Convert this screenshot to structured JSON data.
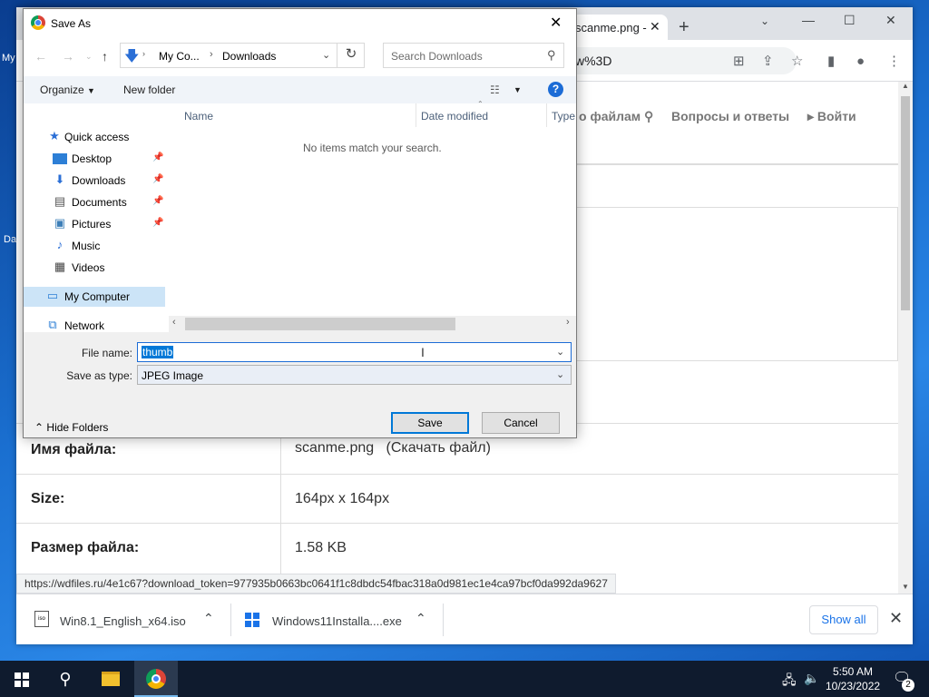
{
  "desktop": {
    "label_my": "My",
    "label_da": "Da"
  },
  "browser": {
    "tab_title": "scanme.png -",
    "tab_close": "✕",
    "new_tab": "+",
    "min": "—",
    "max": "☐",
    "close": "✕",
    "url_fragment": "w%3D",
    "page": {
      "nav_files": "о файлам",
      "nav_faq": "Вопросы и ответы",
      "nav_login": "Войти",
      "rows": [
        {
          "key": "Имя файла:",
          "value": "scanme.png",
          "link": "(Скачать файл)"
        },
        {
          "key": "Size:",
          "value": "164px x 164px"
        },
        {
          "key": "Размер файла:",
          "value": "1.58 KB"
        }
      ]
    },
    "status_url": "https://wdfiles.ru/4e1c67?download_token=977935b0663bc0641f1c8dbdc54fbac318a0d981ec1e4ca97bcf0da992da9627",
    "downloads": [
      {
        "name": "Win8.1_English_x64.iso",
        "icon": "iso-file-icon"
      },
      {
        "name": "Windows11Installa....exe",
        "icon": "windows-logo-icon"
      }
    ],
    "show_all": "Show all",
    "downloads_close": "✕"
  },
  "dialog": {
    "title": "Save As",
    "path": [
      "My Co...",
      "Downloads"
    ],
    "search_placeholder": "Search Downloads",
    "organize": "Organize",
    "new_folder": "New folder",
    "help": "?",
    "nav": [
      {
        "label": "Quick access",
        "icon": "star-icon"
      },
      {
        "label": "Desktop",
        "icon": "desktop-icon",
        "pinned": true
      },
      {
        "label": "Downloads",
        "icon": "download-arrow-icon",
        "pinned": true
      },
      {
        "label": "Documents",
        "icon": "document-icon",
        "pinned": true
      },
      {
        "label": "Pictures",
        "icon": "pictures-icon",
        "pinned": true
      },
      {
        "label": "Music",
        "icon": "music-icon"
      },
      {
        "label": "Videos",
        "icon": "video-icon"
      },
      {
        "label": "My Computer",
        "icon": "computer-icon",
        "selected": true
      },
      {
        "label": "Network",
        "icon": "network-icon"
      }
    ],
    "columns": [
      "Name",
      "Date modified",
      "Type"
    ],
    "empty_message": "No items match your search.",
    "file_name_label": "File name:",
    "file_name_value": "thumb",
    "save_type_label": "Save as type:",
    "save_type_value": "JPEG Image",
    "save": "Save",
    "cancel": "Cancel",
    "hide_folders": "Hide Folders"
  },
  "taskbar": {
    "time": "5:50 AM",
    "date": "10/23/2022",
    "notifications": "2"
  }
}
